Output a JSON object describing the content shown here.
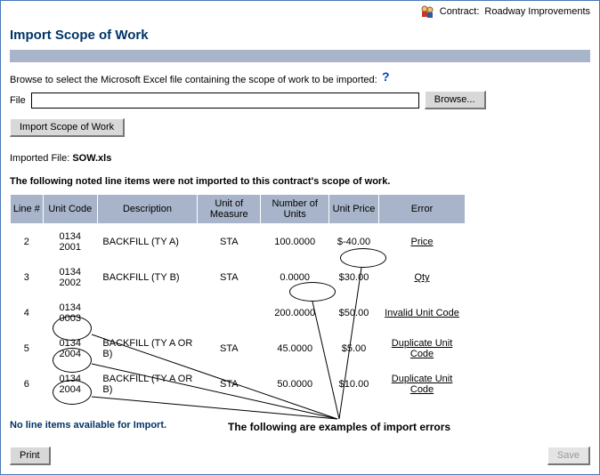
{
  "contract": {
    "label": "Contract:",
    "name": "Roadway Improvements"
  },
  "title": "Import Scope of Work",
  "instruction": "Browse to select the Microsoft Excel file containing the scope of work to be imported:",
  "help_mark": "?",
  "file_label": "File",
  "file_value": "",
  "browse_label": "Browse...",
  "import_btn_label": "Import Scope of Work",
  "imported_file_prefix": "Imported File:",
  "imported_file_name": "SOW.xls",
  "note_heading": "The following noted line items were not imported to this contract's scope of work.",
  "columns": {
    "line": "Line #",
    "unitcode": "Unit Code",
    "desc": "Description",
    "uom": "Unit of Measure",
    "num": "Number of Units",
    "price": "Unit Price",
    "error": "Error"
  },
  "rows": [
    {
      "line": "2",
      "unitcode": "0134 2001",
      "desc": "BACKFILL (TY A)",
      "uom": "STA",
      "num": "100.0000",
      "price": "$-40.00",
      "error": "Price"
    },
    {
      "line": "3",
      "unitcode": "0134 2002",
      "desc": "BACKFILL (TY B)",
      "uom": "STA",
      "num": "0.0000",
      "price": "$30.00",
      "error": "Qty"
    },
    {
      "line": "4",
      "unitcode": "0134 0003",
      "desc": "",
      "uom": "",
      "num": "200.0000",
      "price": "$50.00",
      "error": "Invalid Unit Code"
    },
    {
      "line": "5",
      "unitcode": "0134 2004",
      "desc": "BACKFILL (TY A OR B)",
      "uom": "STA",
      "num": "45.0000",
      "price": "$5.00",
      "error": "Duplicate Unit Code"
    },
    {
      "line": "6",
      "unitcode": "0134 2004",
      "desc": "BACKFILL (TY A OR B)",
      "uom": "STA",
      "num": "50.0000",
      "price": "$10.00",
      "error": "Duplicate Unit Code"
    }
  ],
  "no_items": "No line items available for Import.",
  "annotation_label": "The following are examples of import errors",
  "print_label": "Print",
  "save_label": "Save"
}
